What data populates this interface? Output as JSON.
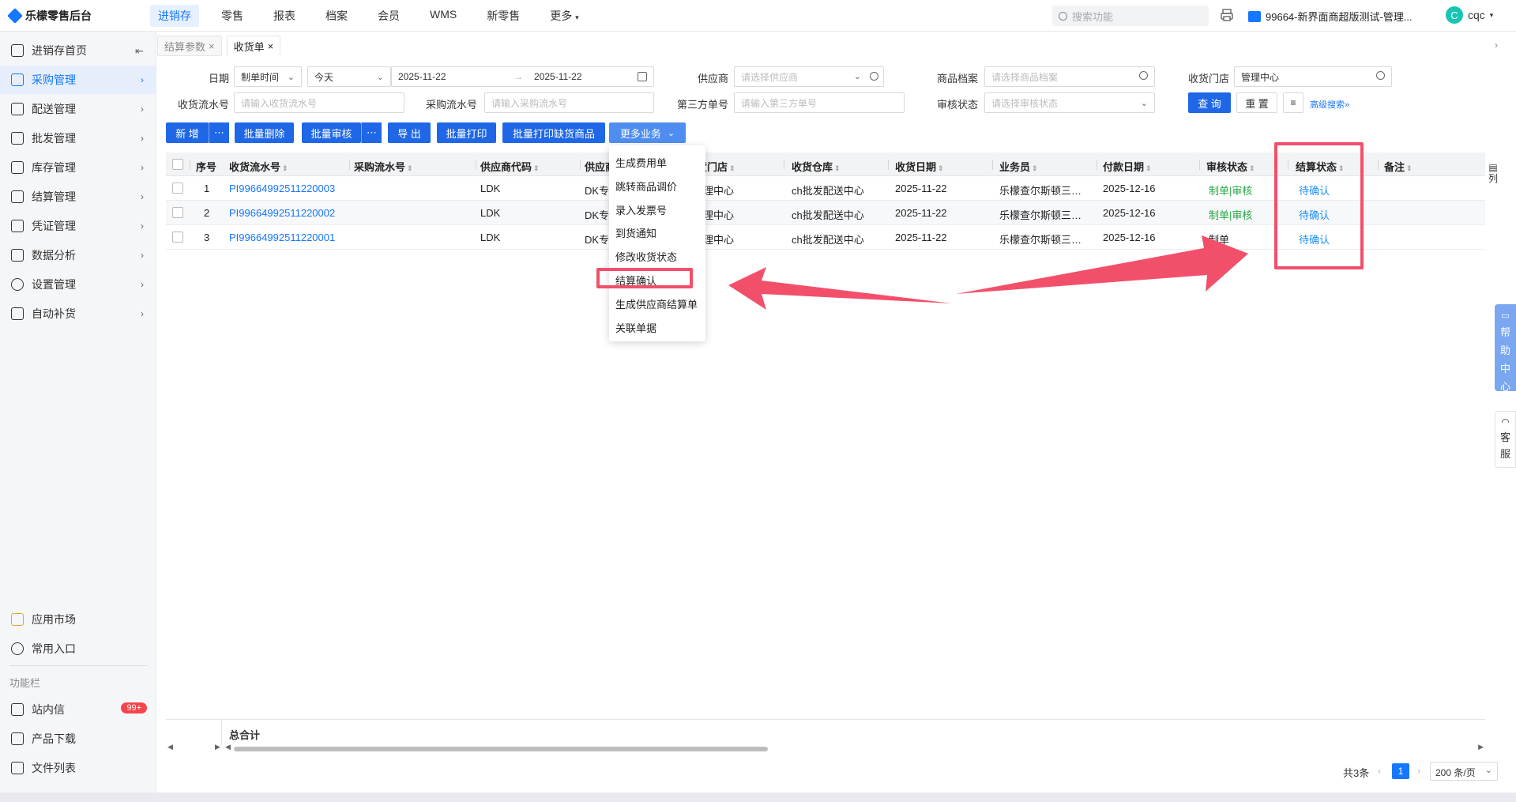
{
  "app": {
    "title": "乐檬零售后台"
  },
  "topnav": [
    {
      "label": "进销存",
      "active": true
    },
    {
      "label": "零售"
    },
    {
      "label": "报表"
    },
    {
      "label": "档案"
    },
    {
      "label": "会员"
    },
    {
      "label": "WMS"
    },
    {
      "label": "新零售"
    },
    {
      "label": "更多"
    }
  ],
  "top": {
    "search_placeholder": "搜索功能",
    "store": "99664-新界面商超版测试-管理...",
    "user_initial": "C",
    "user_name": "cqc"
  },
  "sidebar": {
    "items": [
      {
        "label": "进销存首页"
      },
      {
        "label": "采购管理",
        "active": true
      },
      {
        "label": "配送管理"
      },
      {
        "label": "批发管理"
      },
      {
        "label": "库存管理"
      },
      {
        "label": "结算管理"
      },
      {
        "label": "凭证管理"
      },
      {
        "label": "数据分析"
      },
      {
        "label": "设置管理"
      },
      {
        "label": "自动补货"
      }
    ],
    "bottom": [
      {
        "label": "应用市场"
      },
      {
        "label": "常用入口"
      }
    ],
    "section_title": "功能栏",
    "tools": [
      {
        "label": "站内信",
        "badge": "99+"
      },
      {
        "label": "产品下载"
      },
      {
        "label": "文件列表"
      }
    ]
  },
  "tabs": [
    {
      "label": "结算参数"
    },
    {
      "label": "收货单",
      "active": true
    }
  ],
  "filters": {
    "date_label": "日期",
    "date_type": "制单时间",
    "date_range": "今天",
    "date_start": "2025-11-22",
    "date_end": "2025-11-22",
    "supplier_label": "供应商",
    "supplier_placeholder": "请选择供应商",
    "product_label": "商品档案",
    "product_placeholder": "请选择商品档案",
    "store_label": "收货门店",
    "store_value": "管理中心",
    "receipt_no_label": "收货流水号",
    "receipt_no_placeholder": "请输入收货流水号",
    "purchase_no_label": "采购流水号",
    "purchase_no_placeholder": "请输入采购流水号",
    "third_no_label": "第三方单号",
    "third_no_placeholder": "请输入第三方单号",
    "audit_label": "审核状态",
    "audit_placeholder": "请选择审核状态",
    "query_btn": "查 询",
    "reset_btn": "重 置",
    "advanced": "高级搜索"
  },
  "actions": {
    "add": "新 增",
    "batch_delete": "批量删除",
    "batch_audit": "批量审核",
    "export": "导 出",
    "batch_print": "批量打印",
    "batch_print_short": "批量打印缺货商品",
    "more": "更多业务"
  },
  "more_menu": [
    "生成费用单",
    "跳转商品调价",
    "录入发票号",
    "到货通知",
    "修改收货状态",
    "结算确认",
    "生成供应商结算单",
    "关联单据"
  ],
  "table": {
    "headers": [
      "序号",
      "收货流水号",
      "采购流水号",
      "供应商代码",
      "供应商",
      "收货门店",
      "收货仓库",
      "收货日期",
      "业务员",
      "付款日期",
      "审核状态",
      "结算状态",
      "备注"
    ],
    "header_visible": {
      "supplier": "供应商",
      "store": "货门店"
    },
    "rows": [
      {
        "idx": "1",
        "receipt_no": "PI99664992511220003",
        "purchase_no": "",
        "supplier_code": "LDK",
        "supplier": "DK专",
        "store": "理中心",
        "warehouse": "ch批发配送中心",
        "date": "2025-11-22",
        "salesman": "乐檬查尔斯顿三…",
        "pay_date": "2025-12-16",
        "audit_a": "制单",
        "audit_b": "审核",
        "settle": "待确认"
      },
      {
        "idx": "2",
        "receipt_no": "PI99664992511220002",
        "purchase_no": "",
        "supplier_code": "LDK",
        "supplier": "DK专",
        "store": "理中心",
        "warehouse": "ch批发配送中心",
        "date": "2025-11-22",
        "salesman": "乐檬查尔斯顿三…",
        "pay_date": "2025-12-16",
        "audit_a": "制单",
        "audit_b": "审核",
        "settle": "待确认"
      },
      {
        "idx": "3",
        "receipt_no": "PI99664992511220001",
        "purchase_no": "",
        "supplier_code": "LDK",
        "supplier": "DK专",
        "store": "理中心",
        "warehouse": "ch批发配送中心",
        "date": "2025-11-22",
        "salesman": "乐檬查尔斯顿三…",
        "pay_date": "2025-12-16",
        "audit_a": "制单",
        "audit_b": "",
        "settle": "待确认"
      }
    ],
    "col_setting": "列",
    "total_label": "总合计"
  },
  "pager": {
    "total": "共3条",
    "current": "1",
    "size": "200 条/页"
  },
  "float": {
    "help": [
      "帮",
      "助",
      "中",
      "心"
    ],
    "service": [
      "客",
      "服"
    ]
  },
  "colors": {
    "primary": "#1f67e6",
    "annotation": "#f2506a",
    "audit_green": "#28a745"
  }
}
